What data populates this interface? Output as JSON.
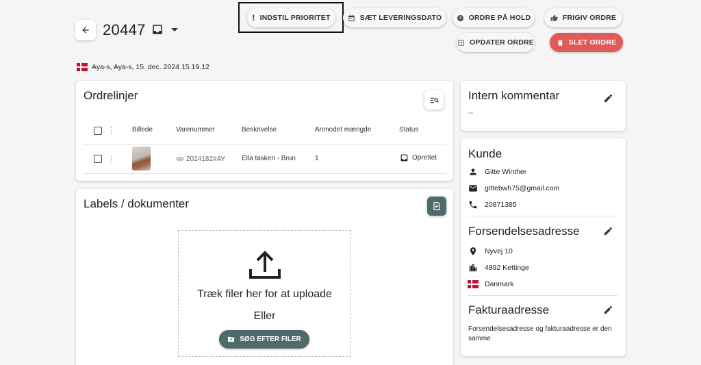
{
  "header": {
    "order_number": "20447",
    "meta": "Aya-s, Aya-s, 15. dec. 2024 15.19.12"
  },
  "actions": {
    "set_priority": "INDSTIL PRIORITET",
    "set_delivery_date": "SÆT LEVERINGSDATO",
    "hold_order": "ORDRE PÅ HOLD",
    "release_order": "FRIGIV ORDRE",
    "update_order": "OPDATER ORDRE",
    "delete_order": "SLET ORDRE",
    "delete_color": "#e05a58"
  },
  "order_lines": {
    "title": "Ordrelinjer",
    "columns": [
      "Billede",
      "Varenummer",
      "Beskrivelse",
      "Anmodet mængde",
      "Status"
    ],
    "rows": [
      {
        "sku": "2024182#AY",
        "description": "Ella tasken - Brun",
        "quantity": "1",
        "status": "Oprettet",
        "status_icon": "inbox-icon"
      }
    ]
  },
  "labels": {
    "title": "Labels / dokumenter",
    "drop_text": "Træk filer her for at uploade",
    "or_text": "Eller",
    "search_button": "SØG EFTER FILER",
    "accent_color": "#4f6b69"
  },
  "internal_comment": {
    "title": "Intern kommentar",
    "value": "--"
  },
  "customer": {
    "title": "Kunde",
    "name": "Gitte Winther",
    "email": "gittebwh75@gmail.com",
    "phone": "20871385"
  },
  "shipping": {
    "title": "Forsendelsesadresse",
    "street": "Nyvej 10",
    "city": "4892 Kettinge",
    "country": "Danmark"
  },
  "billing": {
    "title": "Fakturaadresse",
    "note": "Forsendelsesadresse og fakturaadresse er den samme"
  }
}
